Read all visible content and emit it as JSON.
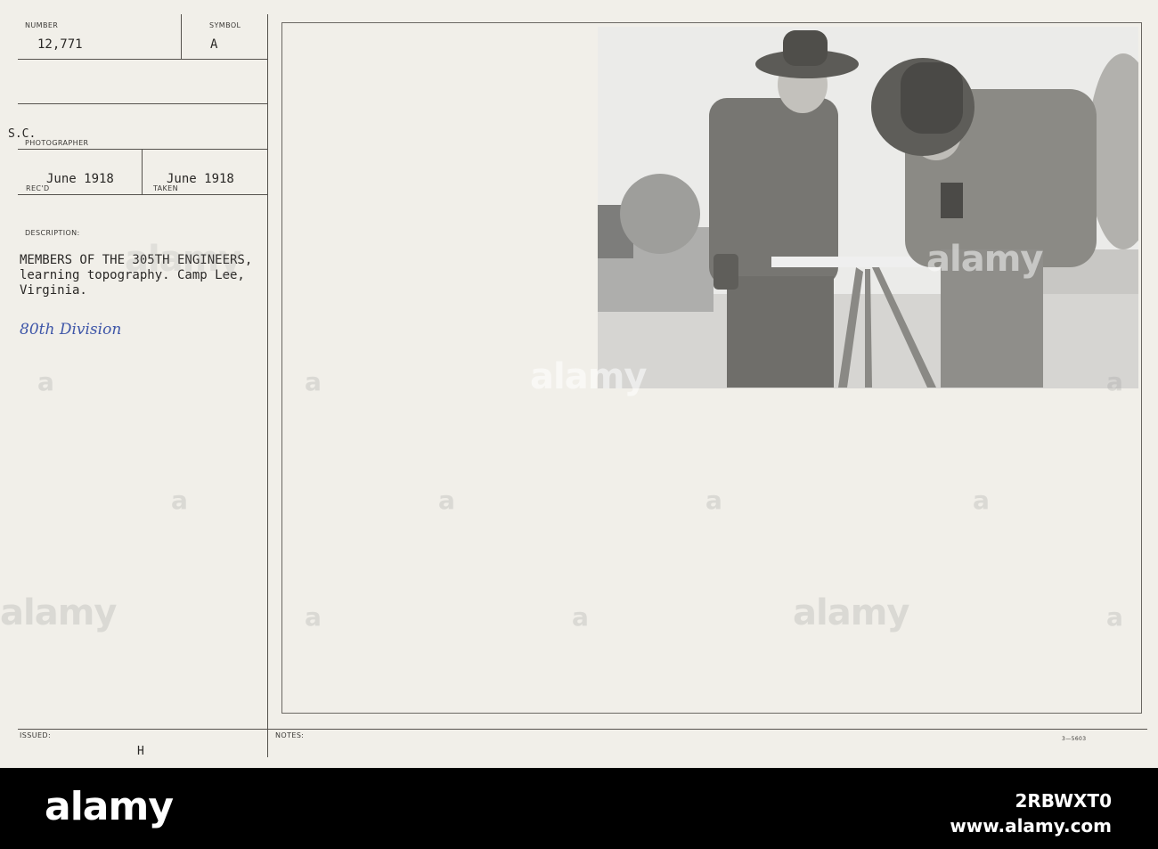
{
  "card": {
    "number_label": "NUMBER",
    "number_value": "12,771",
    "symbol_label": "SYMBOL",
    "symbol_value": "A",
    "photographer_label": "PHOTOGRAPHER",
    "photographer_value": "S.C.",
    "recd_label": "REC'D",
    "recd_value": "June 1918",
    "taken_label": "TAKEN",
    "taken_value": "June 1918",
    "description_label": "DESCRIPTION:",
    "description_lines": [
      "MEMBERS OF THE 305TH ENGINEERS,",
      "learning topography. Camp Lee,",
      "Virginia."
    ],
    "handwritten_note": "80th Division",
    "issued_label": "ISSUED:",
    "issued_value": "H",
    "notes_label": "NOTES:",
    "form_code": "3—5603"
  },
  "watermark": {
    "text": "alamy",
    "letter": "a"
  },
  "banner": {
    "logo": "alamy",
    "image_id": "2RBWXT0",
    "site": "www.alamy.com"
  }
}
